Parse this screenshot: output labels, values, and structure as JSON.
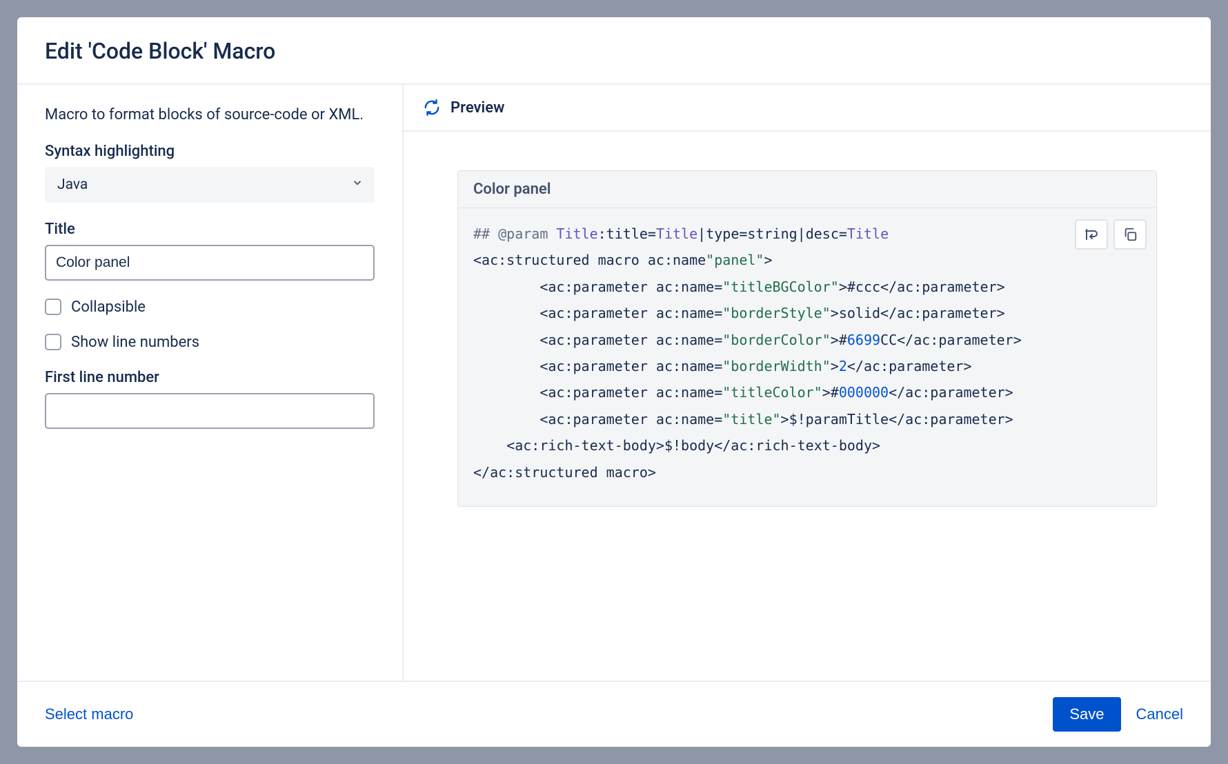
{
  "dialog": {
    "title": "Edit 'Code Block' Macro"
  },
  "left": {
    "description": "Macro to format blocks of source-code or XML.",
    "syntax": {
      "label": "Syntax highlighting",
      "value": "Java"
    },
    "title": {
      "label": "Title",
      "value": "Color panel"
    },
    "collapsible": {
      "label": "Collapsible",
      "checked": false
    },
    "showLineNumbers": {
      "label": "Show line numbers",
      "checked": false
    },
    "firstLine": {
      "label": "First line number",
      "value": ""
    }
  },
  "preview": {
    "header": "Preview",
    "card_title": "Color panel",
    "code": {
      "l1a": "## @param ",
      "l1b": "Title",
      "l1c": ":title=",
      "l1d": "Title",
      "l1e": "|type=string|desc=",
      "l1f": "Title",
      "l2a": "<ac:structured macro ac:name",
      "l2b": "\"panel\"",
      "l2c": ">",
      "p_open": "        <ac:parameter ac:name=",
      "p_close_open": ">",
      "p_close": "</ac:parameter>",
      "p1_name": "\"titleBGColor\"",
      "p1_val": "#ccc",
      "p2_name": "\"borderStyle\"",
      "p2_val": "solid",
      "p3_name": "\"borderColor\"",
      "p3_val_h": "#",
      "p3_val_n": "6699",
      "p3_val_t": "CC",
      "p4_name": "\"borderWidth\"",
      "p4_val": "2",
      "p5_name": "\"titleColor\"",
      "p5_val_h": "#",
      "p5_val_n": "000000",
      "p6_name": "\"title\"",
      "p6_val": "$!paramTitle",
      "rt_a": "    <ac:rich-text-body>",
      "rt_b": "$!body",
      "rt_c": "</ac:rich-text-body>",
      "close": "</ac:structured macro>"
    }
  },
  "footer": {
    "select_macro": "Select macro",
    "save": "Save",
    "cancel": "Cancel"
  }
}
